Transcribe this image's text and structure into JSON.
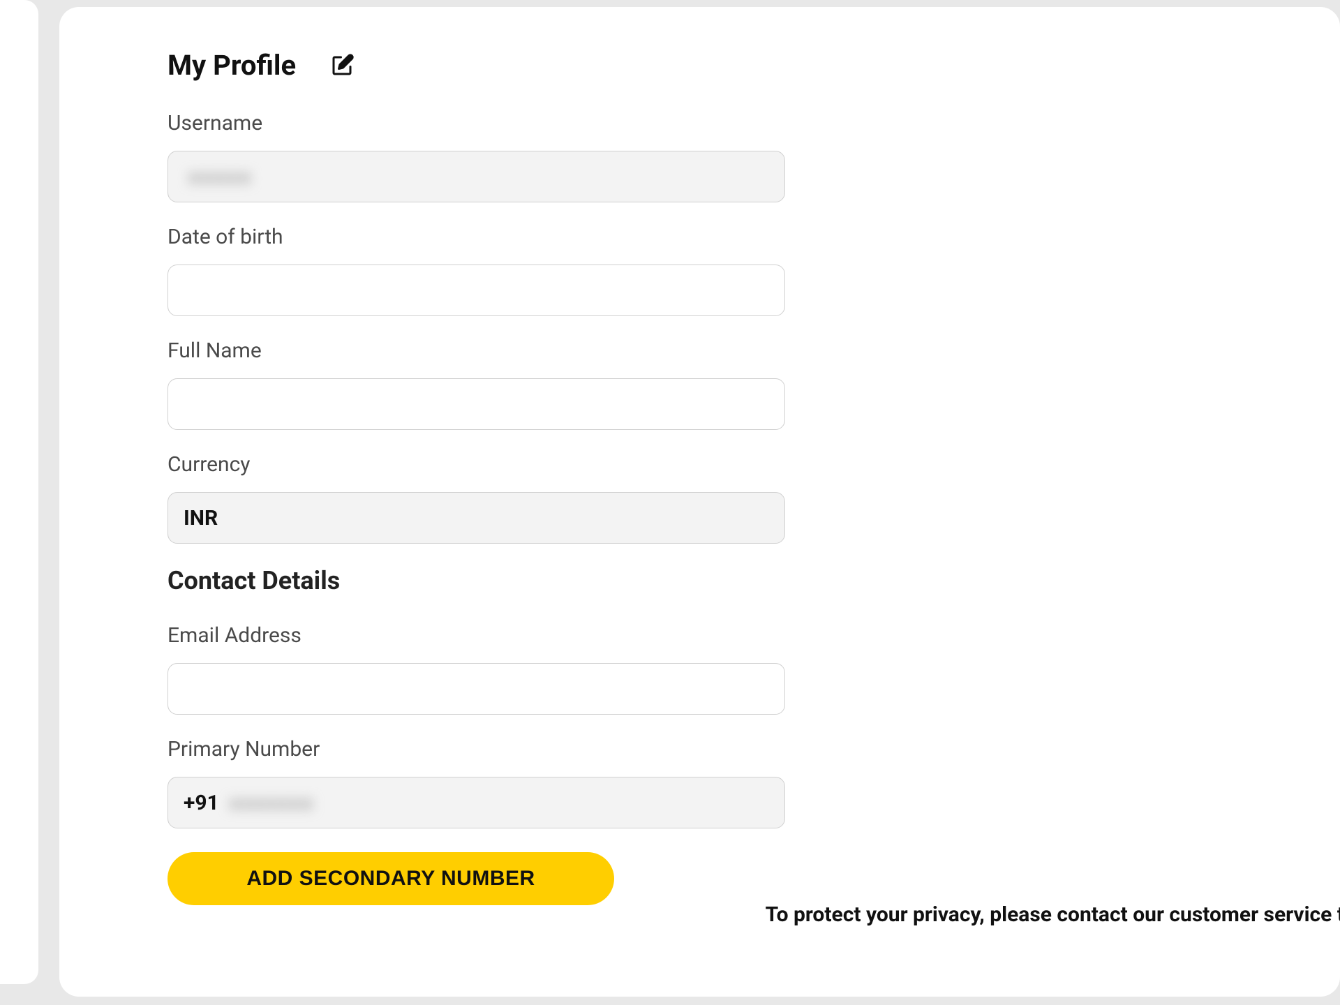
{
  "header": {
    "title": "My Profile"
  },
  "fields": {
    "username": {
      "label": "Username",
      "value": "",
      "blur_placeholder": "xxxxxx"
    },
    "dob": {
      "label": "Date of birth",
      "value": ""
    },
    "fullname": {
      "label": "Full Name",
      "value": ""
    },
    "currency": {
      "label": "Currency",
      "value": "INR"
    }
  },
  "contact": {
    "heading": "Contact Details",
    "email": {
      "label": "Email Address",
      "value": ""
    },
    "primary": {
      "label": "Primary Number",
      "prefix": "+91",
      "value": "",
      "blur_placeholder": "xxxxxxxx"
    },
    "add_secondary_label": "ADD SECONDARY NUMBER"
  },
  "privacy_note": "To protect your privacy, please contact our customer service t",
  "icons": {
    "edit": "edit-icon"
  }
}
